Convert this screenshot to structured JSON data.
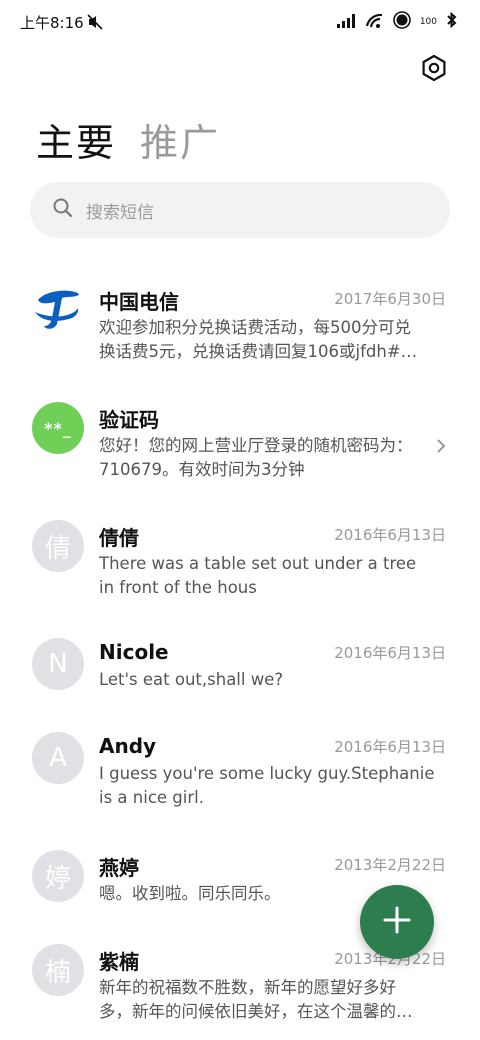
{
  "status_bar": {
    "time": "上午8:16",
    "battery": "100",
    "icons": [
      "mute-icon",
      "signal-icon",
      "wifi-icon",
      "nfc-icon",
      "battery-icon",
      "bluetooth-icon"
    ]
  },
  "header": {
    "settings_icon": "gear-icon"
  },
  "tabs": [
    {
      "label": "主要",
      "active": true
    },
    {
      "label": "推广",
      "active": false
    }
  ],
  "search": {
    "icon": "search-icon",
    "placeholder": "搜索短信"
  },
  "conversations": [
    {
      "avatar_letter": "",
      "avatar_type": "telecom-logo",
      "sender": "中国电信",
      "date": "2017年6月30日",
      "preview_line1": "欢迎参加积分兑换话费活动，每500分可兑",
      "preview_line2": "换话费5元，兑换话费请回复106或jfdh#…"
    },
    {
      "avatar_letter": "**_",
      "avatar_type": "green",
      "sender": "验证码",
      "date": "",
      "preview_line1": "您好！您的网上营业厅登录的随机密码为：",
      "preview_line2": "710679。有效时间为3分钟"
    },
    {
      "avatar_letter": "倩",
      "avatar_type": "gray",
      "sender": "倩倩",
      "date": "2016年6月13日",
      "preview_line1": "There was a table set out under a tree",
      "preview_line2": "in front of the hous"
    },
    {
      "avatar_letter": "N",
      "avatar_type": "gray",
      "sender": "Nicole",
      "date": "2016年6月13日",
      "preview_line1": "Let's eat out,shall we?",
      "preview_line2": ""
    },
    {
      "avatar_letter": "A",
      "avatar_type": "gray",
      "sender": "Andy",
      "date": "2016年6月13日",
      "preview_line1": "I guess you're some lucky guy.Stephanie",
      "preview_line2": "is a nice girl."
    },
    {
      "avatar_letter": "婷",
      "avatar_type": "gray",
      "sender": "燕婷",
      "date": "2013年2月22日",
      "preview_line1": "嗯。收到啦。同乐同乐。",
      "preview_line2": ""
    },
    {
      "avatar_letter": "楠",
      "avatar_type": "gray",
      "sender": "紫楠",
      "date": "2013年2月22日",
      "preview_line1": "新年的祝福数不胜数，新年的愿望好多好",
      "preview_line2": "多，新年的问候依旧美好，在这个温馨的…"
    }
  ],
  "fab": {
    "icon": "plus-icon",
    "color": "#2e7d4f"
  },
  "colors": {
    "accent": "#2e7d4f",
    "verification_avatar": "#6fcf57",
    "telecom_blue": "#0a5fbf"
  }
}
